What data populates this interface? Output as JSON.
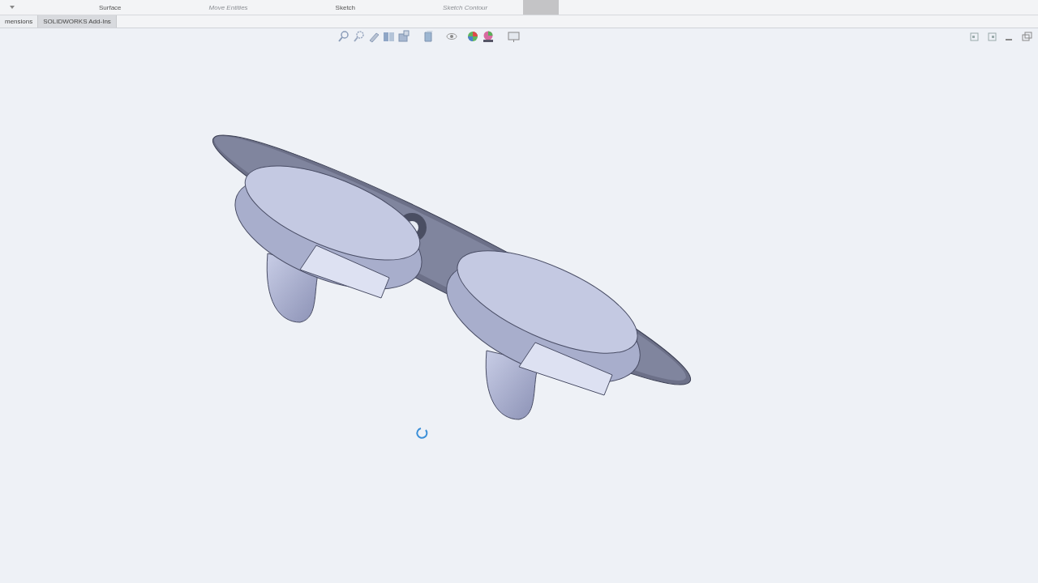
{
  "ribbon": {
    "items": [
      {
        "label": "Surface",
        "disabled": false
      },
      {
        "label": "Move Entities",
        "disabled": true
      },
      {
        "label": "Sketch",
        "disabled": false
      },
      {
        "label": "Sketch Contour",
        "disabled": true
      }
    ]
  },
  "tabs": [
    {
      "label": "mensions",
      "selected": false
    },
    {
      "label": "SOLIDWORKS Add-Ins",
      "selected": true
    }
  ]
}
